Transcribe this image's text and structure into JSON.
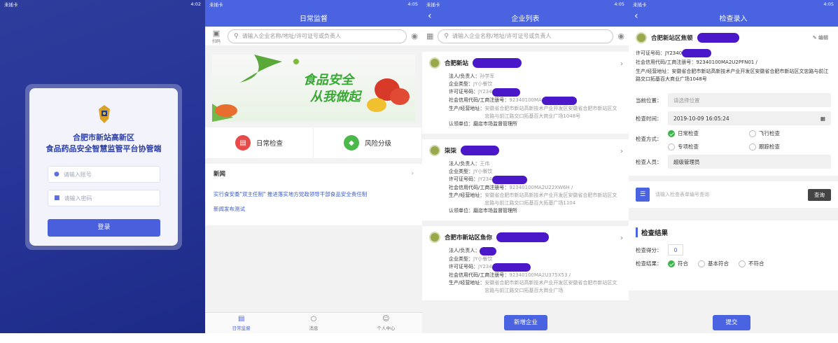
{
  "status_left": "未插卡",
  "times": [
    "4:02",
    "4:05",
    "4:05",
    "4:05"
  ],
  "login": {
    "title_line1": "合肥市新站高新区",
    "title_line2": "食品药品安全智慧监管平台协管端",
    "account_placeholder": "请输入账号",
    "password_placeholder": "请输入密码",
    "login_button": "登录"
  },
  "home": {
    "nav_title": "日常监督",
    "scan_label": "扫码",
    "search_placeholder": "请输入企业名称/地址/许可证号或负责人",
    "banner_slogan1": "食品安全",
    "banner_slogan2": "从我做起",
    "quick_items": [
      {
        "label": "日常检查",
        "color": "#e84a4a"
      },
      {
        "label": "风险分级",
        "color": "#4cb84c"
      }
    ],
    "news_heading": "新闻",
    "news_items": [
      "实行食安委\"双主任制\" 推进落实地方党政领导干部食品安全责任制",
      "新闻发布测试"
    ],
    "tabs": [
      "日常监督",
      "消息",
      "个人中心"
    ]
  },
  "list": {
    "nav_title": "企业列表",
    "search_placeholder": "请输入企业名称/地址/许可证号或负责人",
    "labels": {
      "person": "法人/负责人：",
      "type": "企业类型：",
      "license": "许可证号码：",
      "credit": "社会信用代码/工商注册号：",
      "address": "生产/经营地址：",
      "authority": "认领单位："
    },
    "companies": [
      {
        "name": "合肥新站",
        "person": "孙学军",
        "type": "JY小餐饮",
        "license": "JY234",
        "credit": "92340100MA",
        "address": "安徽省合肥市新站高新技术产业开发区安徽省合肥市新站区文忠路与前江路交口拓基百大商业广场1048号",
        "authority": "磨店市场监督管理所"
      },
      {
        "name": "柒柒",
        "person": "王伟",
        "type": "JY小餐饮",
        "license": "JY234",
        "credit": "92340100MA2U22XW6H /",
        "address": "安徽省合肥市新站高新技术产业开发区安徽省合肥市新站区文忠路与前江路交口拓基百大拓基广场1104",
        "authority": "磨店市场监督管理所"
      },
      {
        "name": "合肥市新站区鱼你",
        "person": "",
        "type": "JY小餐饮",
        "license": "JY234",
        "credit": "92340100MA2U375X53 /",
        "address": "安徽省合肥市新站高新技术产业开发区安徽省合肥市新站区文忠路与前江路交口拓基百大商业广场",
        "authority": ""
      }
    ],
    "add_button": "新增企业"
  },
  "check": {
    "nav_title": "检查录入",
    "company_name": "合肥新站区焦顿",
    "edit_label": "编辑",
    "license_label": "许可证号码：",
    "license_value": "JY2340",
    "credit_label": "社会信用代码/工商注册号：",
    "credit_value": "92340100MA2U2PFN01 /",
    "address_label": "生产/经营地址：",
    "address_value": "安徽省合肥市新站高新技术产业开发区安徽省合肥市新站区文忠路与前江路交口拓基百大商业广场1048号",
    "location_label": "当前位置：",
    "location_placeholder": "请选择位置",
    "time_label": "检查时间：",
    "time_value": "2019-10-09 16:05:24",
    "method_label": "检查方式：",
    "methods": [
      "日常检查",
      "飞行检查",
      "专项检查",
      "跟踪检查"
    ],
    "inspector_label": "检查人员：",
    "inspector_value": "超级管理员",
    "form_search_placeholder": "请输入检查表单编号查询",
    "query_button": "查询",
    "result_title": "检查结果",
    "score_label": "检查得分：",
    "score_value": "0",
    "result_label": "检查结果：",
    "results": [
      "符合",
      "基本符合",
      "不符合"
    ],
    "submit_button": "提交"
  }
}
